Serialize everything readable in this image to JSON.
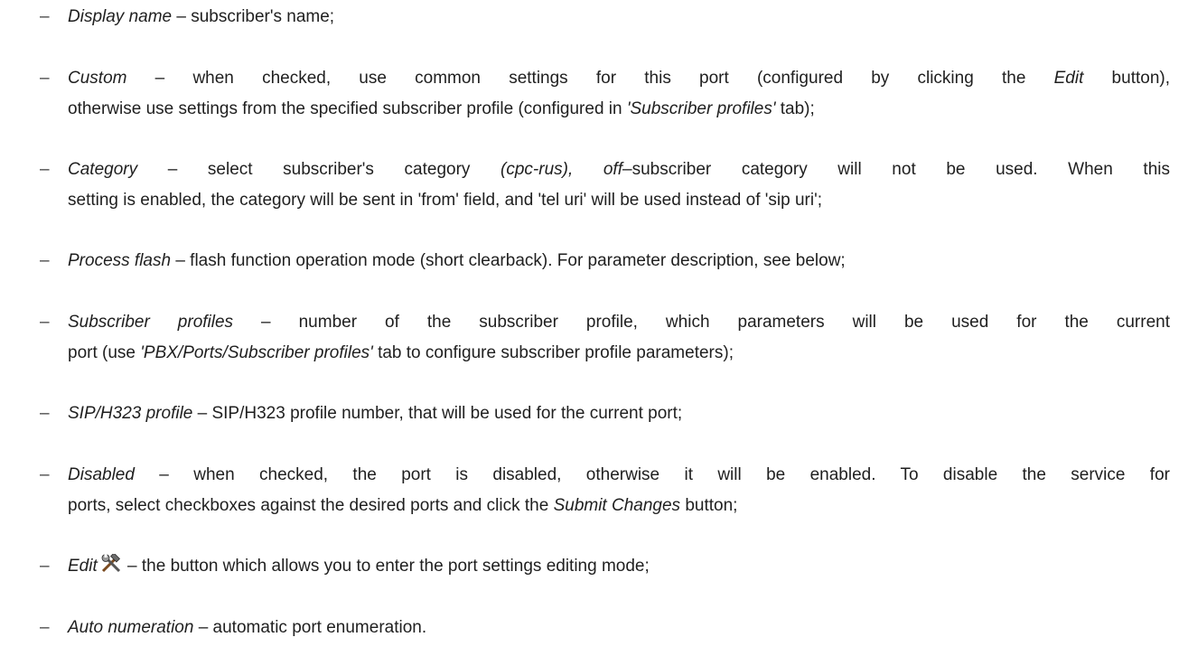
{
  "list": {
    "bullet": "–",
    "items": [
      {
        "term": "Display name",
        "sep": " – ",
        "desc": "subscriber's name;"
      },
      {
        "term": "Custom",
        "line1_a": " – when checked, use common settings for this port (configured by clicking the ",
        "line1_em": "Edit",
        "line1_b": " button),",
        "line2_a": "otherwise use settings from the specified subscriber profile (configured in ",
        "line2_em": "'Subscriber profiles'",
        "line2_b": " tab);"
      },
      {
        "term": "Category",
        "line1_a": " – select subscriber's category ",
        "line1_em": "(cpc-rus), off",
        "line1_b": "–subscriber category will not be used. When this",
        "line2": "setting is enabled, the category will be sent in 'from' field, and 'tel uri' will be used instead of 'sip uri';"
      },
      {
        "term": "Process flash",
        "sep": " – ",
        "desc": "flash function operation mode (short clearback). For parameter description, see below;"
      },
      {
        "term": "Subscriber profiles",
        "line1_b": " – number of the subscriber profile, which parameters will be used for the current",
        "line2_a": "port (use ",
        "line2_em": "'PBX/Ports/Subscriber profiles'",
        "line2_b": " tab to configure subscriber profile parameters);"
      },
      {
        "term": "SIP/H323 profile",
        "sep": " – ",
        "desc": "SIP/H323 profile number, that will be used for the current port;"
      },
      {
        "term": "Disabled",
        "line1_b": " – when checked, the port is disabled, otherwise it will be enabled. To disable the service for",
        "line2_a": "ports, select checkboxes against the desired ports and click the ",
        "line2_em": "Submit Changes",
        "line2_b": " button;"
      },
      {
        "term": "Edit",
        "icon": "tools-icon",
        "sep": " – ",
        "desc": "the button which allows you to enter the port settings editing mode;"
      },
      {
        "term": "Auto numeration",
        "sep": " – ",
        "desc": "automatic port enumeration."
      }
    ]
  }
}
